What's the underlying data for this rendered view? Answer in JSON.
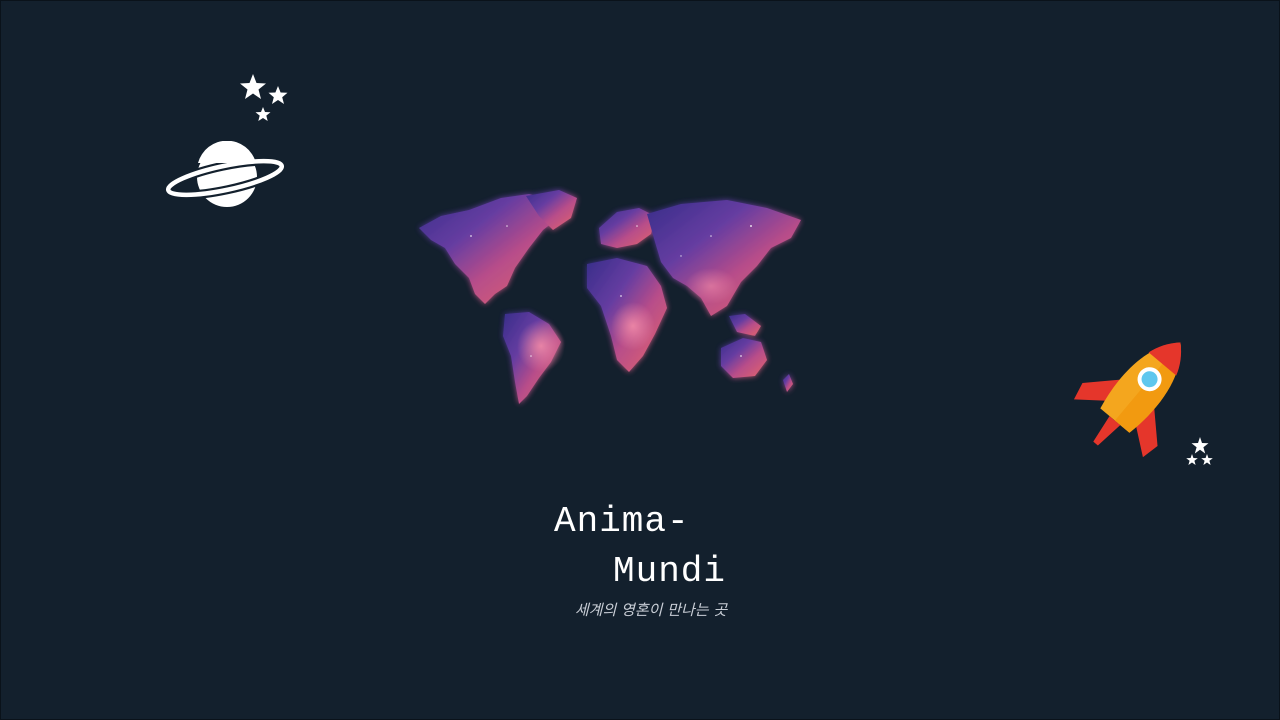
{
  "hero": {
    "title_line1": "Anima-",
    "title_line2": "Mundi",
    "subtitle": "세계의 영혼이 만나는 곳"
  },
  "icons": {
    "stars_top": "stars-icon",
    "planet": "planet-icon",
    "world_map": "world-map-image",
    "rocket": "rocket-icon",
    "stars_right": "stars-icon"
  },
  "colors": {
    "background": "#13202d",
    "title": "#ffffff",
    "subtitle": "#c9ced6",
    "rocket_body": "#f4a61e",
    "rocket_fins": "#e5362b"
  }
}
